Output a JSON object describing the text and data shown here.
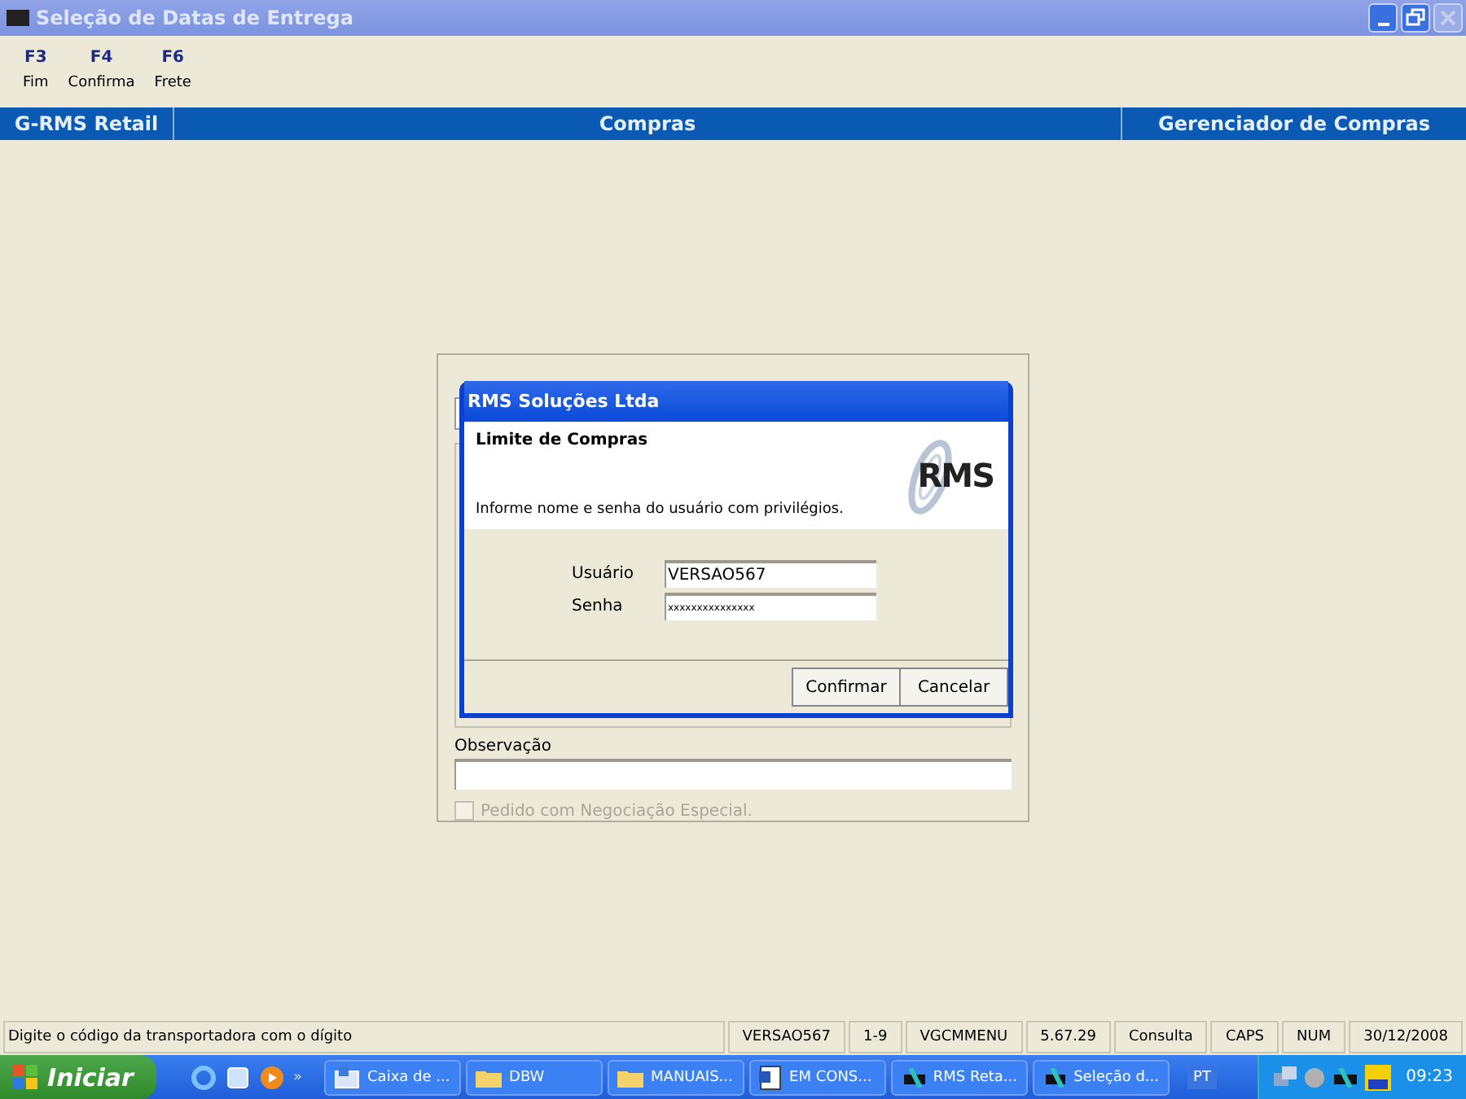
{
  "window": {
    "title": "Seleção de Datas de Entrega"
  },
  "toolbar": [
    {
      "key": "F3",
      "label": "Fim"
    },
    {
      "key": "F4",
      "label": "Confirma"
    },
    {
      "key": "F6",
      "label": "Frete"
    }
  ],
  "header": [
    "G-RMS Retail",
    "Compras",
    "Gerenciador de Compras"
  ],
  "form": {
    "observation_label": "Observação",
    "checkbox": {
      "label": "Pedido com Negociação Especial.",
      "checked": false,
      "disabled": true
    }
  },
  "dialog": {
    "title": "RMS Soluções Ltda",
    "heading": "Limite de Compras",
    "logo": "RMS",
    "message": "Informe nome e senha do usuário com privilégios.",
    "fields": [
      {
        "label": "Usuário",
        "value": "VERSAO567"
      },
      {
        "label": "Senha",
        "value": "xxxxxxxxxxxxxxx"
      }
    ],
    "buttons": [
      "Confirmar",
      "Cancelar"
    ]
  },
  "status_bar": [
    "Digite o código da transportadora com o dígito",
    "VERSAO567",
    "1-9",
    "VGCMMENU",
    "5.67.29",
    "Consulta",
    "CAPS",
    "NUM",
    "30/12/2008"
  ],
  "taskbar": {
    "start": "Iniciar",
    "quicklaunch_more": "»",
    "tasks": [
      "Caixa de ...",
      "DBW",
      "MANUAIS...",
      "EM CONS...",
      "RMS Reta...",
      "Seleção d..."
    ],
    "language": "PT",
    "clock": "09:23"
  }
}
